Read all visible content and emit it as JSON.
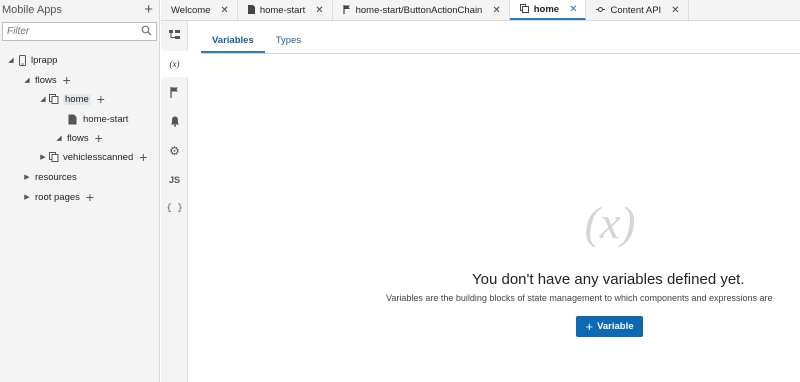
{
  "navigator": {
    "title": "Mobile Apps",
    "filter_placeholder": "Filter",
    "tree": {
      "app": "lprapp",
      "flows": "flows",
      "home": "home",
      "home_start": "home-start",
      "nested_flows": "flows",
      "vehiclesscanned": "vehiclesscanned",
      "resources": "resources",
      "root_pages": "root pages"
    }
  },
  "tabs": [
    {
      "label": "Welcome",
      "icon": "none"
    },
    {
      "label": "home-start",
      "icon": "page-icon"
    },
    {
      "label": "home-start/ButtonActionChain",
      "icon": "action-chain-icon"
    },
    {
      "label": "home",
      "icon": "flow-icon"
    },
    {
      "label": "Content API",
      "icon": "api-icon"
    }
  ],
  "toolbar": {
    "js_label": "JS",
    "braces_label": "{ }",
    "variables_label": "(x)"
  },
  "subtabs": [
    "Variables",
    "Types"
  ],
  "empty_state": {
    "icon_text": "(x)",
    "title": "You don't have any variables defined yet.",
    "description": "Variables are the building blocks of state management to which components and expressions are",
    "button_label": "Variable"
  },
  "colors": {
    "accent": "#0d69b2",
    "tab_underline": "#2a7bbf",
    "panel": "#f4f4f4"
  }
}
